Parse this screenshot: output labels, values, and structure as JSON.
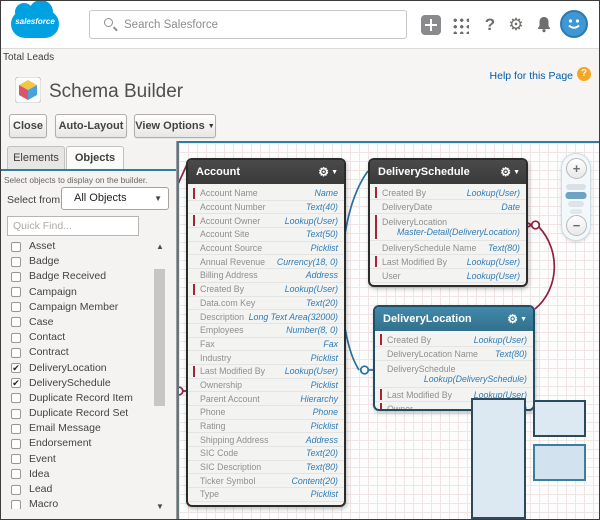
{
  "header": {
    "logo_text": "salesforce",
    "search_placeholder": "Search Salesforce"
  },
  "breadcrumb": "Total Leads",
  "page": {
    "title": "Schema Builder",
    "help_link": "Help for this Page"
  },
  "toolbar": {
    "close": "Close",
    "auto_layout": "Auto-Layout",
    "view_options": "View Options"
  },
  "sidebar": {
    "tabs": [
      {
        "label": "Elements",
        "active": false
      },
      {
        "label": "Objects",
        "active": true
      }
    ],
    "description": "Select objects to display on the builder.",
    "select_from_label": "Select from",
    "select_value": "All Objects",
    "quick_find_placeholder": "Quick Find...",
    "objects": [
      {
        "label": "Asset",
        "checked": false
      },
      {
        "label": "Badge",
        "checked": false
      },
      {
        "label": "Badge Received",
        "checked": false
      },
      {
        "label": "Campaign",
        "checked": false
      },
      {
        "label": "Campaign Member",
        "checked": false
      },
      {
        "label": "Case",
        "checked": false
      },
      {
        "label": "Contact",
        "checked": false
      },
      {
        "label": "Contract",
        "checked": false
      },
      {
        "label": "DeliveryLocation",
        "checked": true
      },
      {
        "label": "DeliverySchedule",
        "checked": true
      },
      {
        "label": "Duplicate Record Item",
        "checked": false
      },
      {
        "label": "Duplicate Record Set",
        "checked": false
      },
      {
        "label": "Email Message",
        "checked": false
      },
      {
        "label": "Endorsement",
        "checked": false
      },
      {
        "label": "Event",
        "checked": false
      },
      {
        "label": "Idea",
        "checked": false
      },
      {
        "label": "Lead",
        "checked": false
      },
      {
        "label": "Macro",
        "checked": false
      }
    ]
  },
  "canvas": {
    "entities": [
      {
        "name": "Account",
        "selected": false,
        "fields": [
          {
            "name": "Account Name",
            "type": "Name",
            "required": true
          },
          {
            "name": "Account Number",
            "type": "Text(40)"
          },
          {
            "name": "Account Owner",
            "type": "Lookup(User)",
            "required": true
          },
          {
            "name": "Account Site",
            "type": "Text(50)"
          },
          {
            "name": "Account Source",
            "type": "Picklist"
          },
          {
            "name": "Annual Revenue",
            "type": "Currency(18, 0)"
          },
          {
            "name": "Billing Address",
            "type": "Address"
          },
          {
            "name": "Created By",
            "type": "Lookup(User)",
            "required": true
          },
          {
            "name": "Data.com Key",
            "type": "Text(20)"
          },
          {
            "name": "Description",
            "type": "Long Text Area(32000)"
          },
          {
            "name": "Employees",
            "type": "Number(8, 0)"
          },
          {
            "name": "Fax",
            "type": "Fax"
          },
          {
            "name": "Industry",
            "type": "Picklist"
          },
          {
            "name": "Last Modified By",
            "type": "Lookup(User)",
            "required": true
          },
          {
            "name": "Ownership",
            "type": "Picklist"
          },
          {
            "name": "Parent Account",
            "type": "Hierarchy"
          },
          {
            "name": "Phone",
            "type": "Phone"
          },
          {
            "name": "Rating",
            "type": "Picklist"
          },
          {
            "name": "Shipping Address",
            "type": "Address"
          },
          {
            "name": "SIC Code",
            "type": "Text(20)"
          },
          {
            "name": "SIC Description",
            "type": "Text(80)"
          },
          {
            "name": "Ticker Symbol",
            "type": "Content(20)"
          },
          {
            "name": "Type",
            "type": "Picklist"
          }
        ]
      },
      {
        "name": "DeliverySchedule",
        "selected": false,
        "fields": [
          {
            "name": "Created By",
            "type": "Lookup(User)",
            "required": true
          },
          {
            "name": "DeliveryDate",
            "type": "Date"
          },
          {
            "name": "DeliveryLocation",
            "type": "Master-Detail(DeliveryLocation)",
            "required": true,
            "two_line": true
          },
          {
            "name": "DeliverySchedule Name",
            "type": "Text(80)"
          },
          {
            "name": "Last Modified By",
            "type": "Lookup(User)",
            "required": true
          },
          {
            "name": "User",
            "type": "Lookup(User)"
          }
        ]
      },
      {
        "name": "DeliveryLocation",
        "selected": true,
        "fields": [
          {
            "name": "Created By",
            "type": "Lookup(User)",
            "required": true
          },
          {
            "name": "DeliveryLocation Name",
            "type": "Text(80)"
          },
          {
            "name": "DeliverySchedule",
            "type": "Lookup(DeliverySchedule)",
            "two_line": true
          },
          {
            "name": "Last Modified By",
            "type": "Lookup(User)",
            "required": true
          },
          {
            "name": "Owner",
            "type": "Lookup(User)",
            "required": true
          }
        ]
      }
    ]
  },
  "zoom_control": {
    "zoom_in": "+",
    "zoom_out": "−"
  },
  "glyphs": {
    "gear": "⚙",
    "caret_down": "▼",
    "check": "✔",
    "help": "?",
    "scroll_up": "▲",
    "scroll_down": "▼"
  },
  "colors": {
    "brand_blue": "#00a1e0",
    "accent_teal": "#2e7da3",
    "field_type_blue": "#2f7cb7",
    "required_red": "#a32638",
    "connector_blue": "#26719f",
    "connector_red": "#8f2040",
    "entity_header_dark": "#414141",
    "entity_header_selected": "#3a81a2",
    "help_badge_orange": "#f5a623"
  }
}
